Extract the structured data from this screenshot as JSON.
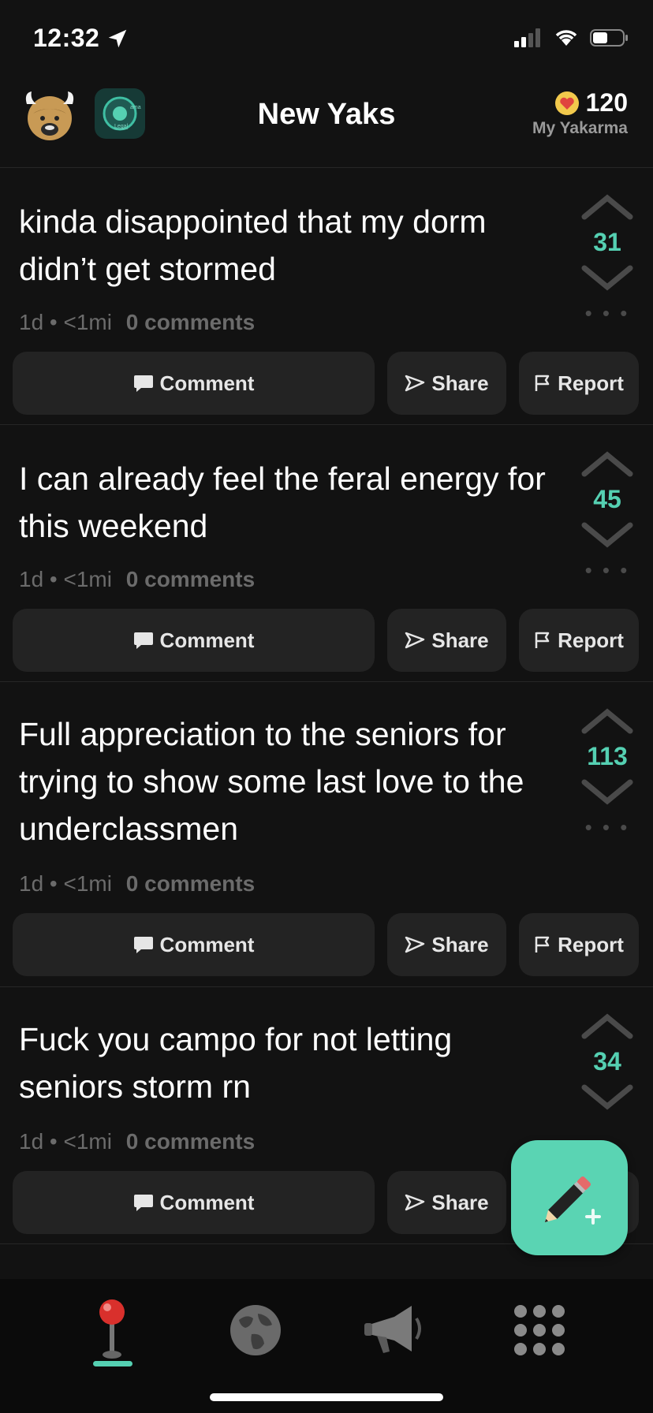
{
  "status_bar": {
    "time": "12:32"
  },
  "header": {
    "title": "New Yaks",
    "yakarma_value": "120",
    "yakarma_label": "My Yakarma",
    "badge_text_top": "ama",
    "badge_text_bottom": "Legal"
  },
  "posts": [
    {
      "text": "kinda disappointed that my dorm didn’t get stormed",
      "votes": "31",
      "meta": "1d • <1mi",
      "comments": "0 comments"
    },
    {
      "text": "I can already feel the feral energy for this weekend",
      "votes": "45",
      "meta": "1d • <1mi",
      "comments": "0 comments"
    },
    {
      "text": "Full appreciation to the seniors for trying to show some last love to the underclassmen",
      "votes": "113",
      "meta": "1d • <1mi",
      "comments": "0 comments"
    },
    {
      "text": "Fuck you campo for not letting seniors storm rn",
      "votes": "34",
      "meta": "1d • <1mi",
      "comments": "0 comments"
    }
  ],
  "actions": {
    "comment": "Comment",
    "share": "Share",
    "report": "Report"
  },
  "more_glyph": "• • •",
  "colors": {
    "accent": "#55d0b2",
    "background": "#121212",
    "button": "#232323",
    "fab": "#5ad4b3"
  },
  "icons": {
    "nav": [
      "joystick-icon",
      "globe-icon",
      "megaphone-icon",
      "grid-icon"
    ],
    "fab": "pencil-plus-icon"
  }
}
